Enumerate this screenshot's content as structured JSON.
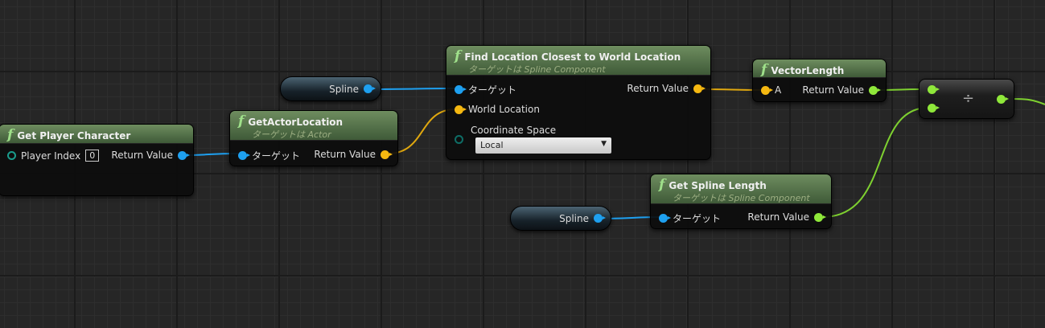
{
  "nodes": {
    "get_player_character": {
      "title": "Get Player Character",
      "player_index_label": "Player Index",
      "player_index_value": "0",
      "return_label": "Return Value"
    },
    "get_actor_location": {
      "title": "GetActorLocation",
      "subtitle": "ターゲットは Actor",
      "target_label": "ターゲット",
      "return_label": "Return Value"
    },
    "spline_var_1": {
      "label": "Spline"
    },
    "spline_var_2": {
      "label": "Spline"
    },
    "find_location": {
      "title": "Find Location Closest to World Location",
      "subtitle": "ターゲットは Spline Component",
      "target_label": "ターゲット",
      "world_location_label": "World Location",
      "coordinate_space_label": "Coordinate Space",
      "coordinate_space_value": "Local",
      "return_label": "Return Value"
    },
    "vector_length": {
      "title": "VectorLength",
      "a_label": "A",
      "return_label": "Return Value"
    },
    "divide": {
      "symbol": "÷"
    },
    "get_spline_length": {
      "title": "Get Spline Length",
      "subtitle": "ターゲットは Spline Component",
      "target_label": "ターゲット",
      "return_label": "Return Value"
    }
  },
  "colors": {
    "object_pin": "#1ea0f0",
    "vector_pin": "#f5b811",
    "float_pin": "#8fe83a",
    "header": "#5a7a4c"
  }
}
